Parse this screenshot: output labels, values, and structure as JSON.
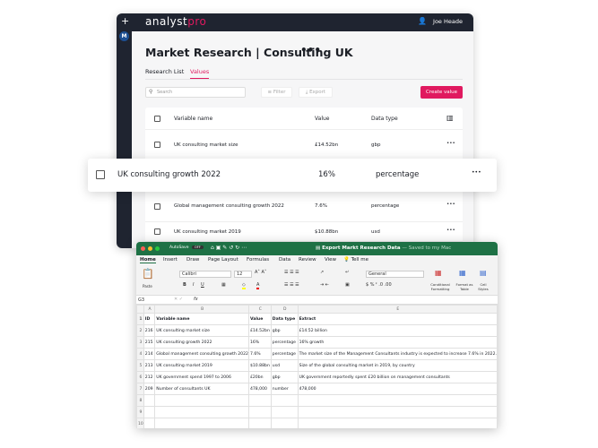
{
  "app": {
    "logo": "analyst",
    "logo_accent": "pro",
    "user": "Joe Heade",
    "avatar": "M",
    "plus": "+",
    "page_title": "Market Research | Consulting UK",
    "more": "•••",
    "tabs": [
      {
        "label": "Research List"
      },
      {
        "label": "Values"
      }
    ],
    "search_placeholder": "Search",
    "filter": "Filter",
    "export": "Export",
    "create": "Create value",
    "columns": {
      "name": "Variable name",
      "value": "Value",
      "type": "Data type"
    },
    "rows": [
      {
        "name": "UK consulting market size",
        "value": "£14.52bn",
        "type": "gbp"
      },
      {
        "name": "Global management consulting growth 2022",
        "value": "7.6%",
        "type": "percentage"
      },
      {
        "name": "UK consulting market 2019",
        "value": "$10.88bn",
        "type": "usd"
      }
    ],
    "highlight": {
      "name": "UK consulting growth 2022",
      "value": "16%",
      "type": "percentage"
    }
  },
  "excel": {
    "autosave": "AutoSave",
    "off": "OFF",
    "title": "Export Markt Research Data",
    "saved": "— Saved to my Mac",
    "tabs": [
      "Home",
      "Insert",
      "Draw",
      "Page Layout",
      "Formulas",
      "Data",
      "Review",
      "View",
      "Tell me"
    ],
    "font": "Calibri",
    "size": "12",
    "format": "General",
    "paste": "Paste",
    "cond": "Conditional Formatting",
    "fmt_table": "Format as Table",
    "cell_styles": "Cell Styles",
    "cell_ref": "G3",
    "fx": "fx",
    "cols": [
      "A",
      "B",
      "C",
      "D",
      "E"
    ],
    "rows": [
      [
        "ID",
        "Variable name",
        "Value",
        "Data type",
        "Extract"
      ],
      [
        "216",
        "UK consulting market size",
        "£14.52bn",
        "gbp",
        "£14.52 billion"
      ],
      [
        "215",
        "UK consulting growth 2022",
        "16%",
        "percentage",
        "16% growth"
      ],
      [
        "214",
        "Global management consulting growth 2022",
        "7.6%",
        "percentage",
        "The market size of the Management Consultants industry is expected to increase 7.6% in 2022."
      ],
      [
        "213",
        "UK consulting market 2019",
        "$10.88bn",
        "usd",
        "Size of the global consulting market in 2019, by country"
      ],
      [
        "212",
        "UK government spend 1997 to 2006",
        "£20bn",
        "gbp",
        "UK government reportedly spent £20 billion on management consultants"
      ],
      [
        "209",
        "Number of consultants UK",
        "478,000",
        "number",
        "478,000"
      ],
      [
        "",
        "",
        "",
        "",
        ""
      ],
      [
        "",
        "",
        "",
        "",
        ""
      ],
      [
        "",
        "",
        "",
        "",
        ""
      ]
    ]
  }
}
